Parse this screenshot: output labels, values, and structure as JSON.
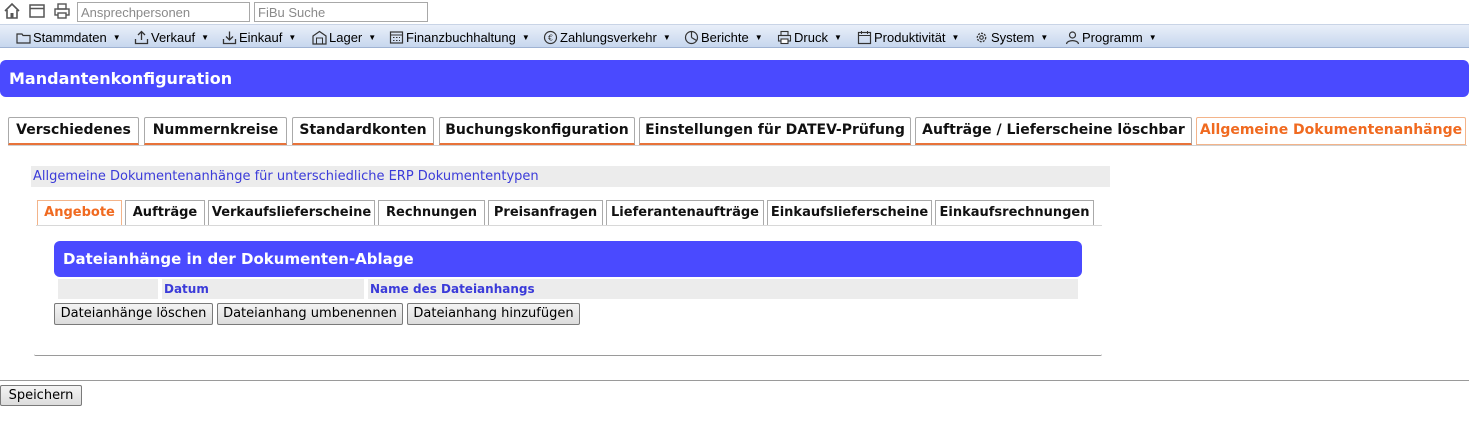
{
  "topbar": {
    "icons": [
      "home-icon",
      "window-icon",
      "printer-icon"
    ],
    "search_contacts_placeholder": "Ansprechpersonen",
    "search_fibu_placeholder": "FiBu Suche"
  },
  "menu": {
    "items": [
      {
        "label": "Stammdaten",
        "icon": "folder-icon"
      },
      {
        "label": "Verkauf",
        "icon": "upload-icon"
      },
      {
        "label": "Einkauf",
        "icon": "download-icon"
      },
      {
        "label": "Lager",
        "icon": "warehouse-icon"
      },
      {
        "label": "Finanzbuchhaltung",
        "icon": "calculator-icon"
      },
      {
        "label": "Zahlungsverkehr",
        "icon": "euro-icon"
      },
      {
        "label": "Berichte",
        "icon": "pie-chart-icon"
      },
      {
        "label": "Druck",
        "icon": "printer-icon"
      },
      {
        "label": "Produktivität",
        "icon": "calendar-icon"
      },
      {
        "label": "System",
        "icon": "gear-icon"
      },
      {
        "label": "Programm",
        "icon": "user-icon"
      }
    ]
  },
  "page": {
    "title": "Mandantenkonfiguration"
  },
  "main_tabs": [
    {
      "label": "Verschiedenes",
      "active": false
    },
    {
      "label": "Nummernkreise",
      "active": false
    },
    {
      "label": "Standardkonten",
      "active": false
    },
    {
      "label": "Buchungskonfiguration",
      "active": false
    },
    {
      "label": "Einstellungen für DATEV-Prüfung",
      "active": false
    },
    {
      "label": "Aufträge / Lieferscheine löschbar",
      "active": false
    },
    {
      "label": "Allgemeine Dokumentenanhänge",
      "active": true
    }
  ],
  "panel": {
    "title": "Allgemeine Dokumentenanhänge für unterschiedliche ERP Dokumententypen",
    "sub_tabs": [
      {
        "label": "Angebote",
        "active": true
      },
      {
        "label": "Aufträge",
        "active": false
      },
      {
        "label": "Verkaufslieferscheine",
        "active": false
      },
      {
        "label": "Rechnungen",
        "active": false
      },
      {
        "label": "Preisanfragen",
        "active": false
      },
      {
        "label": "Lieferantenaufträge",
        "active": false
      },
      {
        "label": "Einkaufslieferscheine",
        "active": false
      },
      {
        "label": "Einkaufsrechnungen",
        "active": false
      }
    ],
    "attachments": {
      "title": "Dateianhänge in der Dokumenten-Ablage",
      "columns": [
        "",
        "Datum",
        "Name des Dateianhangs"
      ],
      "rows": []
    },
    "buttons": {
      "delete": "Dateianhänge löschen",
      "rename": "Dateianhang umbenennen",
      "add": "Dateianhang hinzufügen"
    }
  },
  "footer": {
    "save_label": "Speichern"
  }
}
